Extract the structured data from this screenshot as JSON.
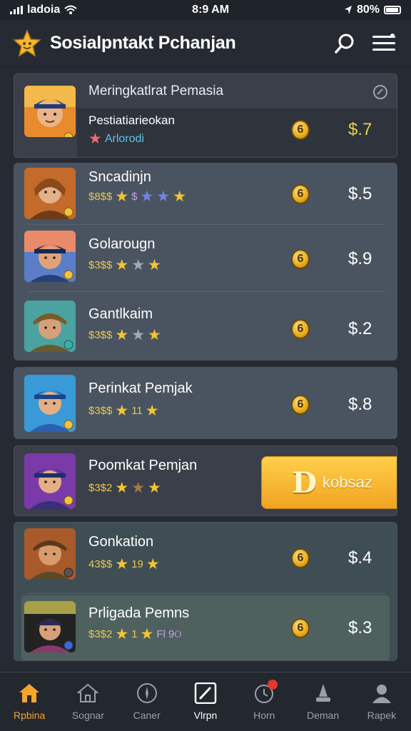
{
  "status": {
    "carrier": "ladoia",
    "time": "8:9 AM",
    "battery": "80%"
  },
  "header": {
    "title": "Sosialpntakt Pchanjan"
  },
  "featured": {
    "title": "Meringkatlrat Pemasia",
    "subtitle": "Pestiatiarieokan",
    "tag": "Arlorodi",
    "coin": "6",
    "price": "$.7"
  },
  "group1": [
    {
      "name": "Sncadinjn",
      "meta": "$8$$",
      "coin": "6",
      "price": "$.5",
      "extra": "$"
    },
    {
      "name": "Golarougn",
      "meta": "$3$$",
      "coin": "6",
      "price": "$.9"
    },
    {
      "name": "Gantlkaim",
      "meta": "$3$$",
      "coin": "6",
      "price": "$.2"
    }
  ],
  "single": {
    "name": "Perinkat Pemjak",
    "meta": "$3$$",
    "extra": "11",
    "coin": "6",
    "price": "$.8"
  },
  "buy_item": {
    "name": "Poomkat Pemjan",
    "meta": "$3$2",
    "button_letter": "D",
    "button_label": "kobsaz"
  },
  "group2": [
    {
      "name": "Gonkation",
      "meta": "43$$",
      "extra": "19",
      "coin": "6",
      "price": "$.4"
    },
    {
      "name": "Prligada Pemns",
      "meta": "$3$2",
      "extra": "1",
      "extra2": "Fl 9ଠ",
      "coin": "6",
      "price": "$.3"
    }
  ],
  "nav": [
    {
      "label": "Rpbina",
      "icon": "home-icon"
    },
    {
      "label": "Sognar",
      "icon": "house-outline-icon"
    },
    {
      "label": "Caner",
      "icon": "compass-icon"
    },
    {
      "label": "Vlrpn",
      "icon": "edit-icon"
    },
    {
      "label": "Horn",
      "icon": "clock-icon"
    },
    {
      "label": "Deman",
      "icon": "trophy-icon"
    },
    {
      "label": "Rapek",
      "icon": "profile-icon"
    }
  ],
  "colors": {
    "accent": "#f4a52c",
    "gold": "#e8c650",
    "background": "#262b33"
  }
}
